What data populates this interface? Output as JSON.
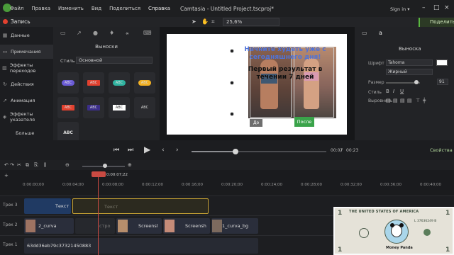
{
  "menu": {
    "items": [
      "Файл",
      "Правка",
      "Изменить",
      "Вид",
      "Поделиться",
      "Справка"
    ],
    "window_title": "Camtasia - Untitled Project.tscproj*",
    "sign_in": "Sign in ▾"
  },
  "toolbar": {
    "record_label": "Запись",
    "zoom_value": "25,6%",
    "share_label": "Поделиться"
  },
  "left_nav": {
    "items": [
      "Данные",
      "Примечания",
      "Эффекты переходов",
      "Действия",
      "Анимация",
      "Эффекты указателя"
    ],
    "more_label": "Больше"
  },
  "library": {
    "title": "Выноски",
    "style_label": "Стиль",
    "style_value": "Основной",
    "tiles": [
      "ABC",
      "ABC",
      "ABC",
      "ABC",
      "ABC",
      "ABC",
      "ABC",
      "ABC",
      "ABC"
    ]
  },
  "canvas": {
    "headline": "Начните худеть уже с сегодняшнего дня!",
    "subline": "Первый результат в течении 7 дней",
    "before_label": "До",
    "after_label": "После"
  },
  "properties": {
    "title": "Выноска",
    "font_label": "Шрифт",
    "font_value": "Tahoma",
    "weight_value": "Жирный",
    "size_label": "Размер",
    "size_value": "91",
    "style_label": "Стиль",
    "align_label": "Выровнять",
    "button_label": "Свойства"
  },
  "playback": {
    "current_time": "00:07",
    "total_time": "00:23",
    "progress": 0.33
  },
  "timeline": {
    "playhead_time": "0:00:07;22",
    "ticks": [
      "0:00:00;00",
      "0:00:04;00",
      "0:00:08;00",
      "0:00:12;00",
      "0:00:16;00",
      "0:00:20;00",
      "0:00:24;00",
      "0:00:28;00",
      "0:00:32;00",
      "0:00:36;00",
      "0:00:40;00"
    ],
    "tracks": [
      {
        "label": "Трек 3",
        "clips": [
          "Текст",
          "Текст"
        ]
      },
      {
        "label": "Трек 2",
        "clips": [
          "2_curva",
          "стро",
          "Screensl",
          "Screensh",
          "1_curva_bg"
        ]
      },
      {
        "label": "Трек 1",
        "clips": [
          "63dd36eb79c37321450883"
        ]
      }
    ]
  },
  "overlay": {
    "top_text": "THE UNITED STATES OF AMERICA",
    "serial": "L 37636249 B",
    "name": "Money Panda",
    "denomination": "1"
  },
  "colors": {
    "accent_green": "#59b640",
    "record_red": "#e2412f",
    "playhead_red": "#c94a42",
    "headline_blue": "#4f73d9"
  }
}
